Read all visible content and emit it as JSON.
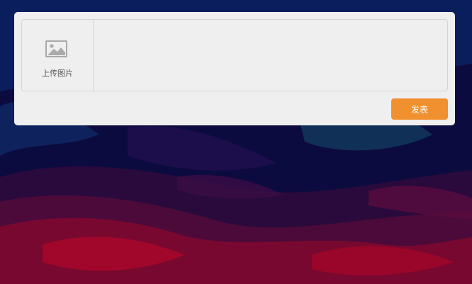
{
  "composer": {
    "upload_label": "上传图片",
    "upload_icon": "image-icon",
    "text_value": "",
    "publish_label": "发表",
    "publish_color": "#f0902f"
  },
  "background": {
    "colors": [
      "#0b0a3e",
      "#1a0f4a",
      "#3a0d3f",
      "#7a0628",
      "#a30528",
      "#103a6a"
    ]
  }
}
